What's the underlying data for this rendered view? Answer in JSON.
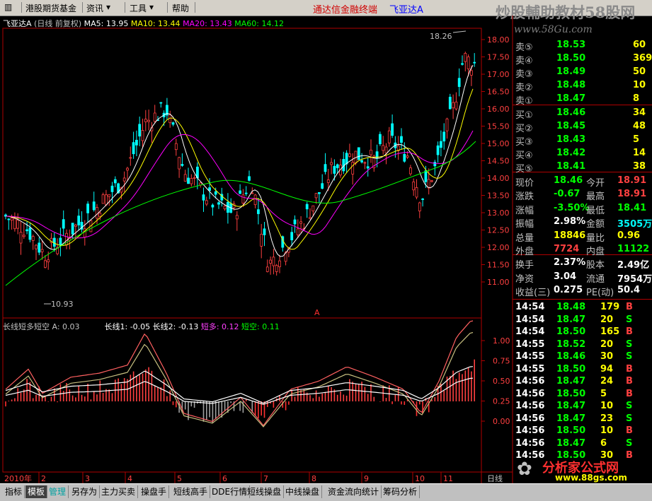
{
  "menu": {
    "items": [
      "港股期货基金",
      "资讯",
      "工具",
      "帮助"
    ],
    "title": "通达信金融终端",
    "stock": "飞亚达A"
  },
  "watermark": {
    "text": "炒股輔助教材58股网",
    "url": "www.58Gu.com"
  },
  "main_chart": {
    "stock_label": "飞亚达A",
    "mode": "(日线 前复权)",
    "ma": [
      {
        "label": "MA5: 13.95",
        "color": "#ffffff"
      },
      {
        "label": "MA10: 13.44",
        "color": "#ffff00"
      },
      {
        "label": "MA20: 13.43",
        "color": "#ff00ff"
      },
      {
        "label": "MA60: 14.12",
        "color": "#00ff00"
      }
    ],
    "y_ticks": [
      "18.00",
      "17.50",
      "17.00",
      "16.50",
      "16.00",
      "15.50",
      "15.00",
      "14.50",
      "14.00",
      "13.50",
      "13.00",
      "12.50",
      "12.00",
      "11.50",
      "11.00"
    ],
    "high_label": "18.26",
    "low_label": "10.93",
    "marker": "A"
  },
  "indicator": {
    "name": "长线短多短空",
    "params": [
      {
        "label": "A: 0.03",
        "color": "#c0c0c0"
      },
      {
        "label": "长线1: -0.05",
        "color": "#ffffff"
      },
      {
        "label": "长线2: -0.13",
        "color": "#ffffff"
      },
      {
        "label": "短多: 0.12",
        "color": "#ff40ff"
      },
      {
        "label": "短空: 0.11",
        "color": "#00ff00"
      }
    ],
    "y_ticks": [
      "1.00",
      "0.75",
      "0.50",
      "0.25",
      "0.00"
    ]
  },
  "x_axis": {
    "labels": [
      "2010年",
      "2",
      "3",
      "4",
      "5",
      "6",
      "7",
      "8",
      "9",
      "10",
      "11"
    ],
    "right": "日线"
  },
  "quote": {
    "asks": [
      {
        "label": "卖⑤",
        "price": "18.53",
        "vol": "60"
      },
      {
        "label": "卖④",
        "price": "18.50",
        "vol": "369"
      },
      {
        "label": "卖③",
        "price": "18.49",
        "vol": "50"
      },
      {
        "label": "卖②",
        "price": "18.48",
        "vol": "10"
      },
      {
        "label": "卖①",
        "price": "18.47",
        "vol": "8"
      }
    ],
    "bids": [
      {
        "label": "买①",
        "price": "18.46",
        "vol": "34"
      },
      {
        "label": "买②",
        "price": "18.45",
        "vol": "48"
      },
      {
        "label": "买③",
        "price": "18.43",
        "vol": "5"
      },
      {
        "label": "买④",
        "price": "18.42",
        "vol": "14"
      },
      {
        "label": "买⑤",
        "price": "18.41",
        "vol": "38"
      }
    ],
    "stats": [
      {
        "k1": "现价",
        "v1": "18.46",
        "k2": "今开",
        "v2": "18.91",
        "c1": "#00ff00",
        "c2": "#ff4040"
      },
      {
        "k1": "涨跌",
        "v1": "-0.67",
        "k2": "最高",
        "v2": "18.91",
        "c1": "#00ff00",
        "c2": "#ff4040"
      },
      {
        "k1": "涨幅",
        "v1": "-3.50%",
        "k2": "最低",
        "v2": "18.41",
        "c1": "#00ff00",
        "c2": "#00ff00"
      },
      {
        "k1": "振幅",
        "v1": "2.98%",
        "k2": "金额",
        "v2": "3505万",
        "c1": "#ffffff",
        "c2": "#00ffff"
      },
      {
        "k1": "总量",
        "v1": "18846",
        "k2": "量比",
        "v2": "0.96",
        "c1": "#ffff00",
        "c2": "#ffff00"
      },
      {
        "k1": "外盘",
        "v1": "7724",
        "k2": "内盘",
        "v2": "11122",
        "c1": "#ff4040",
        "c2": "#00ff00"
      },
      {
        "k1": "换手",
        "v1": "2.37%",
        "k2": "股本",
        "v2": "2.49亿",
        "c1": "#ffffff",
        "c2": "#ffffff"
      },
      {
        "k1": "净资",
        "v1": "3.04",
        "k2": "流通",
        "v2": "7954万",
        "c1": "#ffffff",
        "c2": "#ffffff"
      },
      {
        "k1": "收益(三)",
        "v1": "0.275",
        "k2": "PE(动)",
        "v2": "50.4",
        "c1": "#ffffff",
        "c2": "#ffffff"
      }
    ],
    "ticks": [
      {
        "t": "14:54",
        "p": "18.48",
        "v": "179",
        "s": "B",
        "pc": "#00ff00"
      },
      {
        "t": "14:54",
        "p": "18.47",
        "v": "20",
        "s": "S",
        "pc": "#00ff00"
      },
      {
        "t": "14:54",
        "p": "18.50",
        "v": "165",
        "s": "B",
        "pc": "#00ff00"
      },
      {
        "t": "14:55",
        "p": "18.52",
        "v": "20",
        "s": "S",
        "pc": "#00ff00"
      },
      {
        "t": "14:55",
        "p": "18.46",
        "v": "30",
        "s": "S",
        "pc": "#00ff00"
      },
      {
        "t": "14:55",
        "p": "18.50",
        "v": "94",
        "s": "B",
        "pc": "#00ff00"
      },
      {
        "t": "14:56",
        "p": "18.47",
        "v": "24",
        "s": "B",
        "pc": "#00ff00"
      },
      {
        "t": "14:56",
        "p": "18.50",
        "v": "5",
        "s": "B",
        "pc": "#00ff00"
      },
      {
        "t": "14:56",
        "p": "18.47",
        "v": "10",
        "s": "S",
        "pc": "#00ff00"
      },
      {
        "t": "14:56",
        "p": "18.47",
        "v": "23",
        "s": "S",
        "pc": "#00ff00"
      },
      {
        "t": "14:56",
        "p": "18.50",
        "v": "10",
        "s": "B",
        "pc": "#00ff00"
      },
      {
        "t": "14:56",
        "p": "18.47",
        "v": "6",
        "s": "S",
        "pc": "#00ff00"
      },
      {
        "t": "14:56",
        "p": "18.50",
        "v": "30",
        "s": "B",
        "pc": "#00ff00"
      }
    ]
  },
  "logo": {
    "text": "分析家公式网",
    "url": "www.88gs.com"
  },
  "tabs": [
    "指标",
    "模板",
    "管理",
    "另存为",
    "主力买卖",
    "操盘手",
    "短线高手",
    "DDE行情",
    "短线操盘",
    "中线操盘",
    "资金流向统计",
    "筹码分析"
  ]
}
